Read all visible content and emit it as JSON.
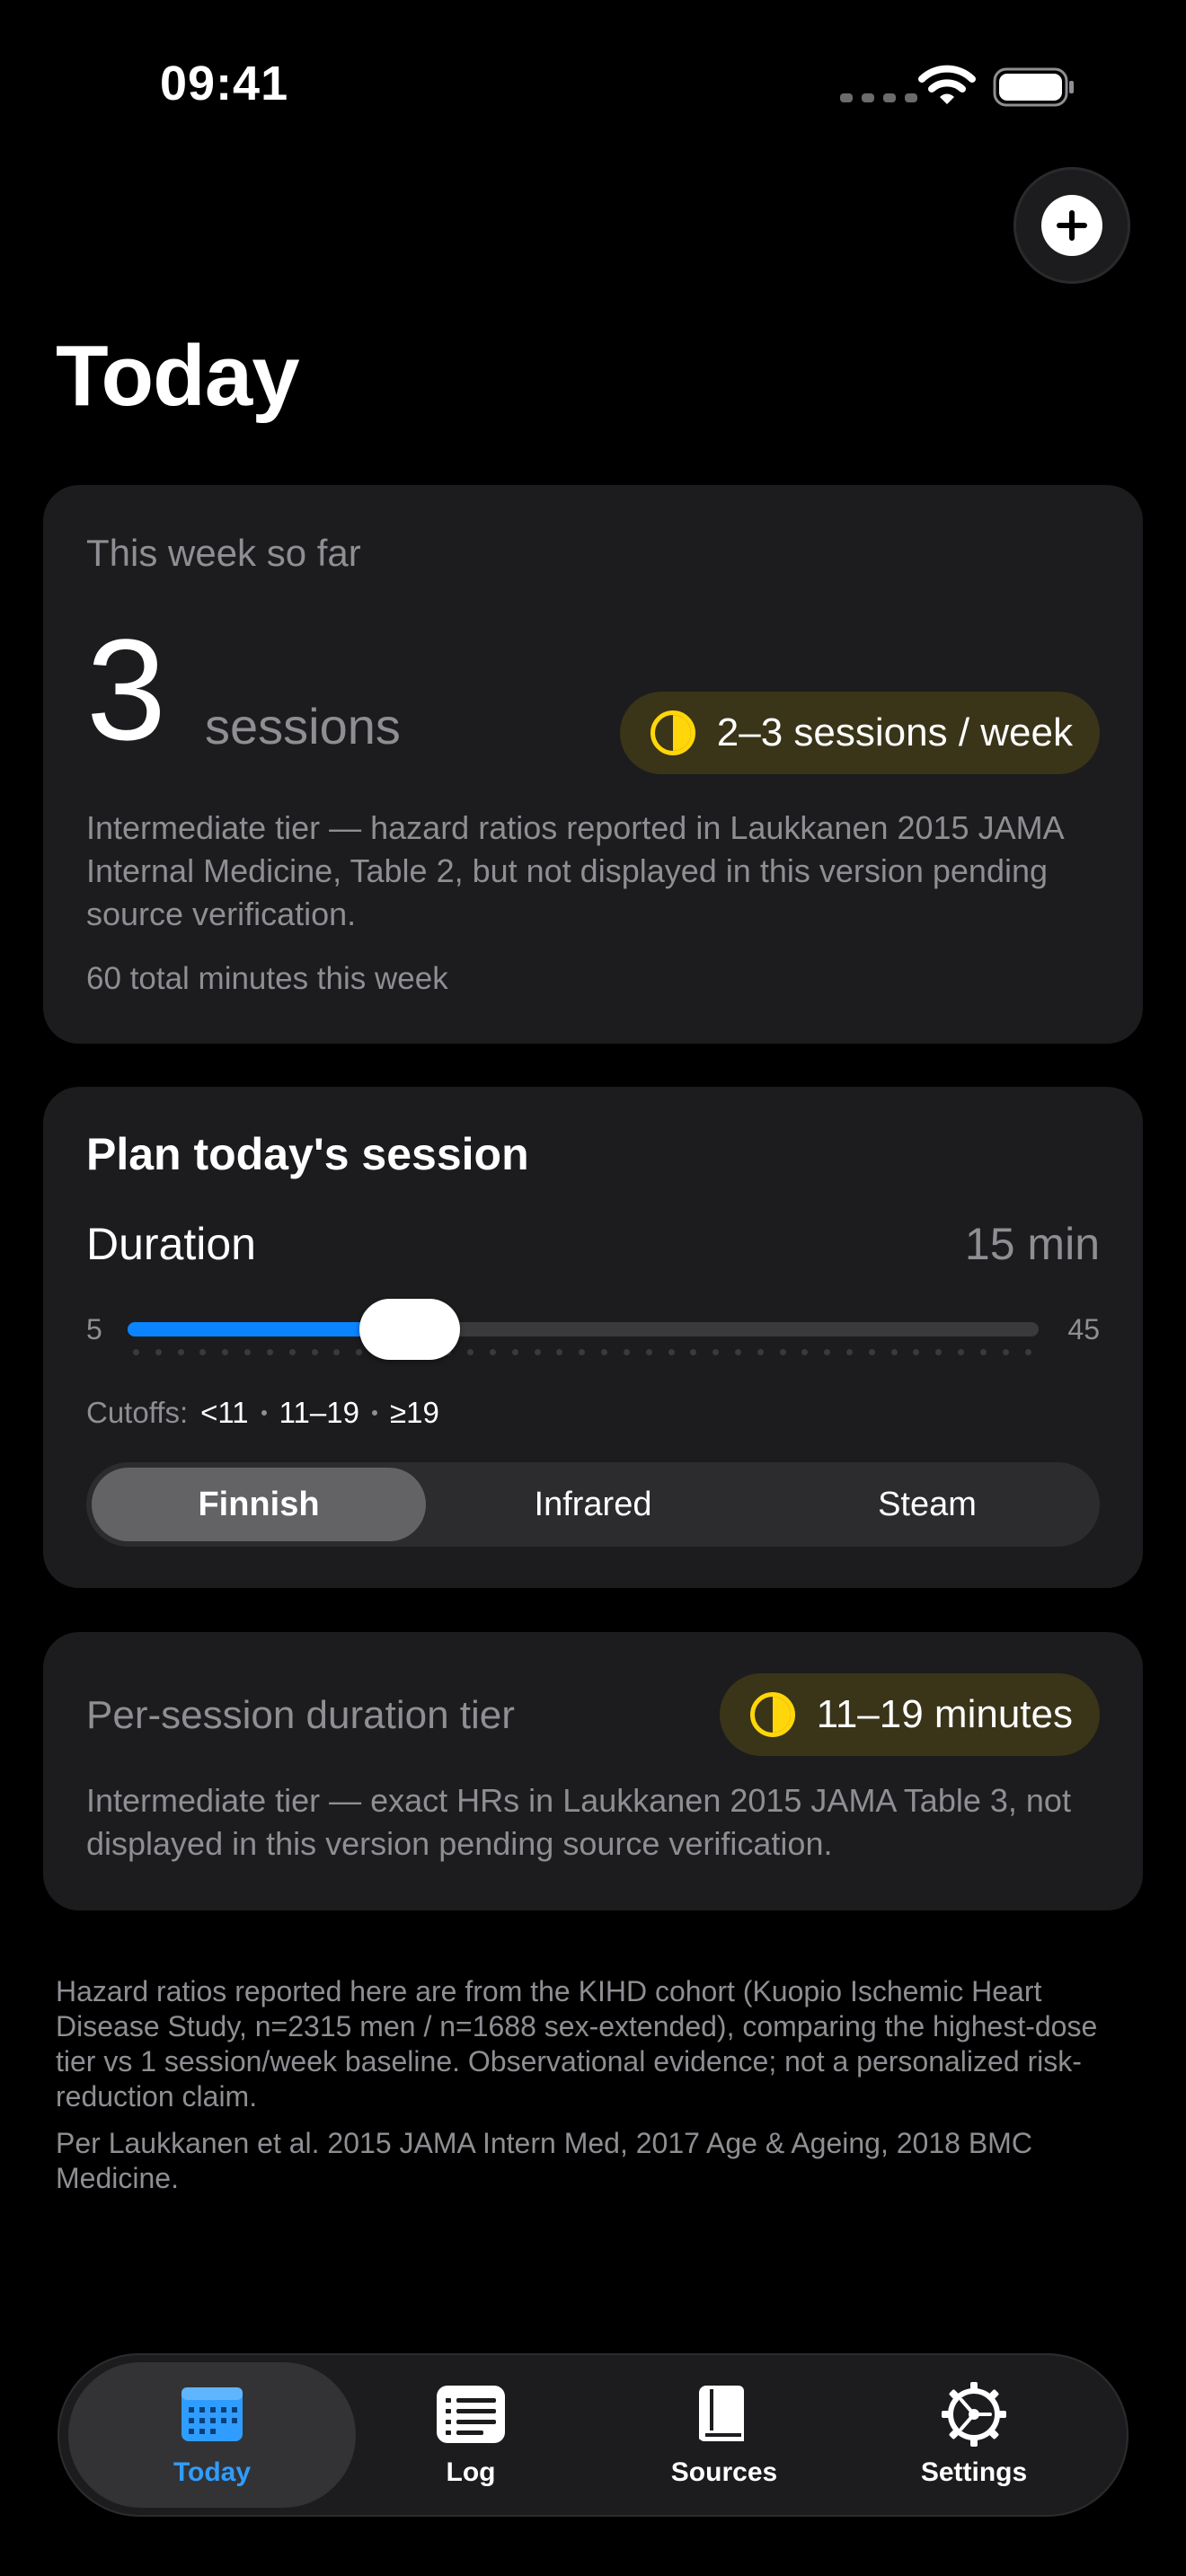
{
  "status_bar": {
    "time": "09:41"
  },
  "header": {
    "title": "Today"
  },
  "summary_card": {
    "label": "This week so far",
    "session_count": "3",
    "unit": "sessions",
    "tier_badge": "2–3 sessions / week",
    "description": "Intermediate tier — hazard ratios reported in Laukkanen 2015 JAMA Internal Medicine, Table 2, but not displayed in this version pending source verification.",
    "total_minutes": "60 total minutes this week"
  },
  "plan_card": {
    "title": "Plan today's session",
    "duration_label": "Duration",
    "duration_value": "15 min",
    "slider": {
      "min_label": "5",
      "max_label": "45",
      "value": 15,
      "min": 5,
      "max": 45
    },
    "cutoffs": {
      "label": "Cutoffs:",
      "items": [
        "<11",
        "11–19",
        "≥19"
      ]
    },
    "types": [
      {
        "label": "Finnish",
        "selected": true
      },
      {
        "label": "Infrared",
        "selected": false
      },
      {
        "label": "Steam",
        "selected": false
      }
    ]
  },
  "duration_card": {
    "label": "Per-session duration tier",
    "tier_badge": "11–19 minutes",
    "description": "Intermediate tier — exact HRs in Laukkanen 2015 JAMA Table 3, not displayed in this version pending source verification."
  },
  "footnotes": {
    "main": "Hazard ratios reported here are from the KIHD cohort (Kuopio Ischemic Heart Disease Study, n=2315 men / n=1688 sex-extended), comparing the highest-dose tier vs 1 session/week baseline. Observational evidence; not a personalized risk-reduction claim.",
    "citation": "Per Laukkanen et al. 2015 JAMA Intern Med, 2017 Age & Ageing, 2018 BMC Medicine."
  },
  "tabbar": {
    "tabs": [
      {
        "label": "Today",
        "icon": "calendar-icon",
        "active": true
      },
      {
        "label": "Log",
        "icon": "list-icon",
        "active": false
      },
      {
        "label": "Sources",
        "icon": "book-icon",
        "active": false
      },
      {
        "label": "Settings",
        "icon": "gear-icon",
        "active": false
      }
    ]
  },
  "colors": {
    "accent": "#0a84ff",
    "tier_yellow": "#ffd60a",
    "tier_pill_bg": "#3a3419",
    "card_bg": "#1c1c1e"
  }
}
